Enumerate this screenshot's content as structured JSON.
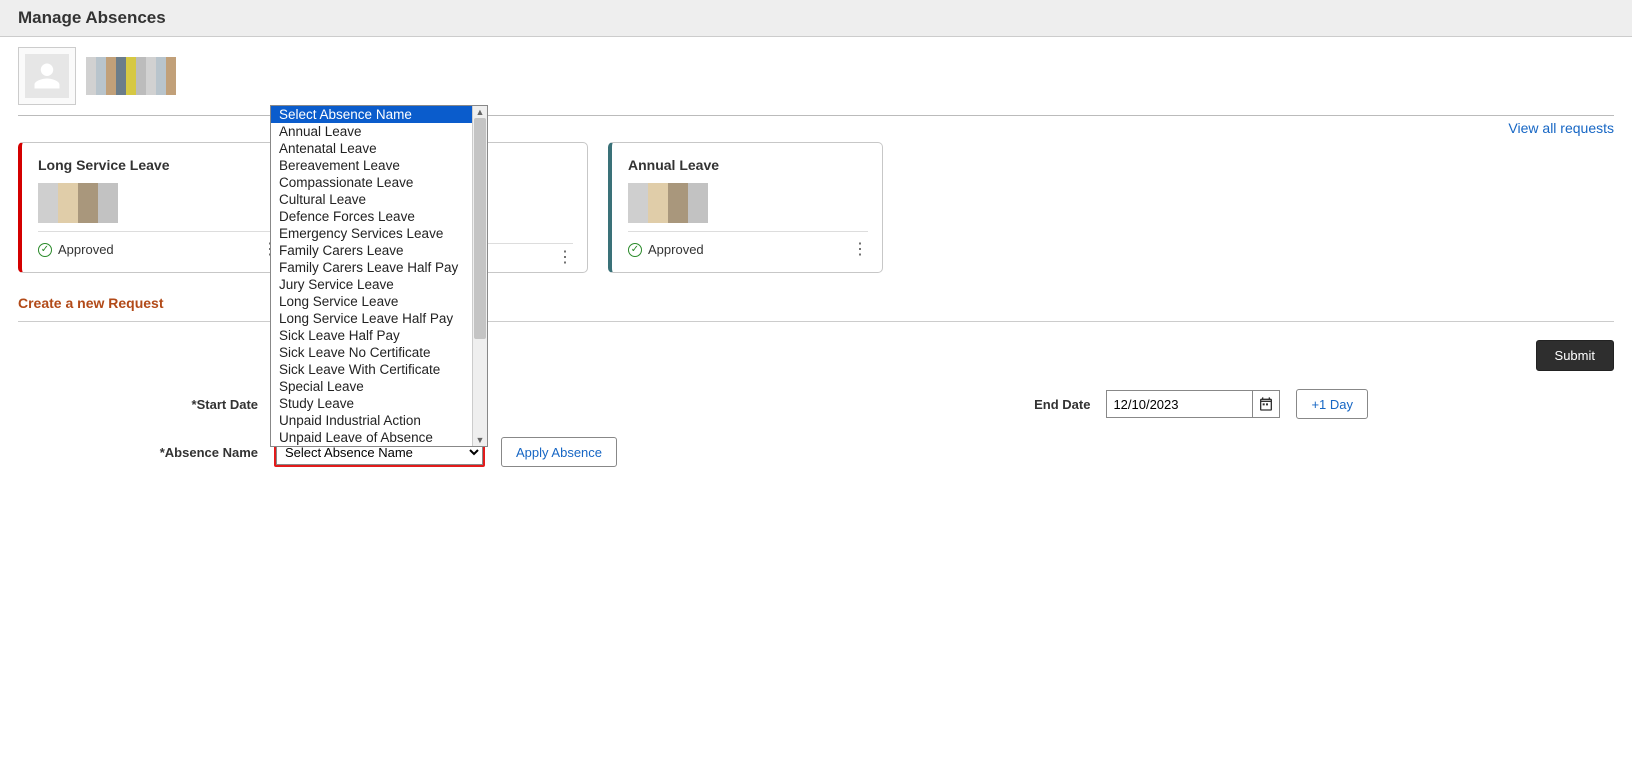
{
  "header": {
    "title": "Manage Absences"
  },
  "links": {
    "view_all": "View all requests"
  },
  "cards": [
    {
      "title": "Long Service Leave",
      "status": "Approved"
    },
    {
      "title": "Annual Leave",
      "status": "Approved"
    }
  ],
  "section": {
    "create_request": "Create a new Request"
  },
  "buttons": {
    "submit": "Submit",
    "plus_day": "+1 Day",
    "apply_absence": "Apply Absence"
  },
  "form": {
    "start_date_label": "*Start Date",
    "end_date_label": "End Date",
    "end_date_value": "12/10/2023",
    "absence_name_label": "*Absence Name",
    "absence_placeholder": "Select Absence Name"
  },
  "dropdown": {
    "options": [
      "Select Absence Name",
      "Annual Leave",
      "Antenatal Leave",
      "Bereavement Leave",
      "Compassionate Leave",
      "Cultural Leave",
      "Defence Forces Leave",
      "Emergency Services Leave",
      "Family Carers Leave",
      "Family Carers Leave Half Pay",
      "Jury Service Leave",
      "Long Service Leave",
      "Long Service Leave Half Pay",
      "Sick Leave Half Pay",
      "Sick Leave No Certificate",
      "Sick Leave With Certificate",
      "Special Leave",
      "Study Leave",
      "Unpaid Industrial Action",
      "Unpaid Leave of Absence"
    ]
  }
}
